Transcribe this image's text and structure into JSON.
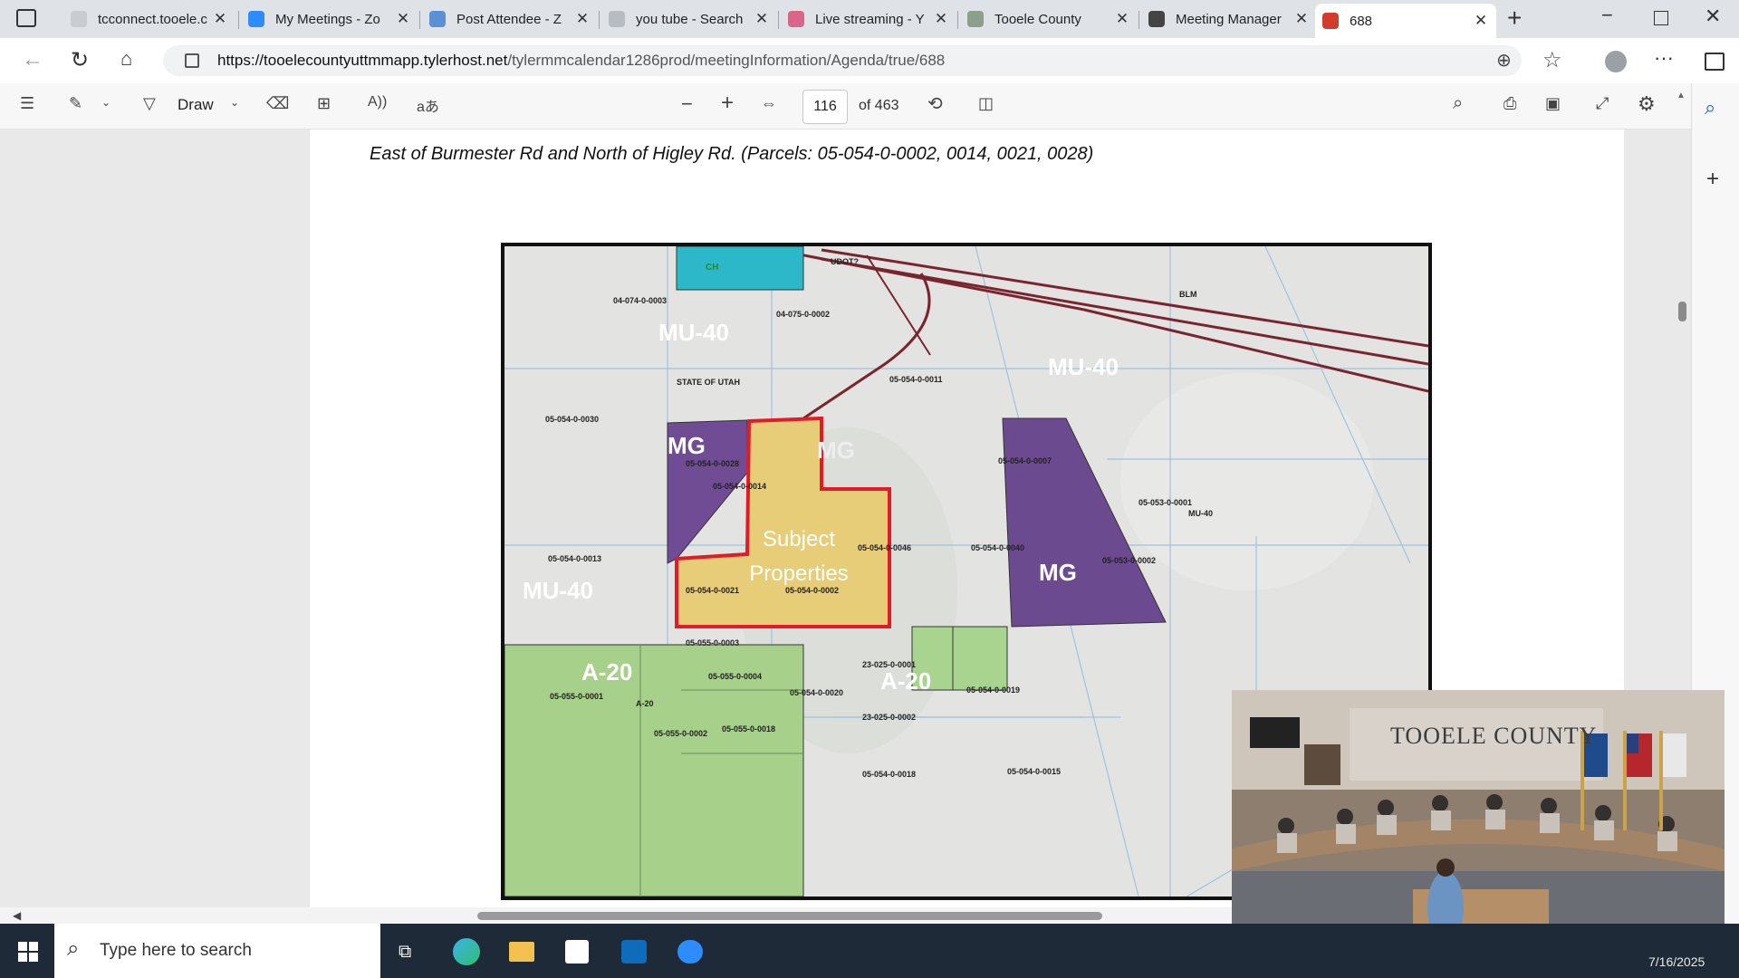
{
  "browser": {
    "tabs": [
      {
        "label": "tcconnect.tooele.c",
        "icon": "page-icon",
        "color": "#c9ccd0"
      },
      {
        "label": "My Meetings - Zo",
        "icon": "zoom-icon",
        "color": "#2d8cff"
      },
      {
        "label": "Post Attendee - Z",
        "icon": "zoom-icon",
        "color": "#5b8fd6"
      },
      {
        "label": "you tube - Search",
        "icon": "search-icon",
        "color": "#b7bcc2"
      },
      {
        "label": "Live streaming - Y",
        "icon": "youtube-icon",
        "color": "#d9668a"
      },
      {
        "label": "Tooele County",
        "icon": "tooele-icon",
        "color": "#8aa08a"
      },
      {
        "label": "Meeting Manager",
        "icon": "globe-icon",
        "color": "#444444"
      },
      {
        "label": "688",
        "icon": "pdf-icon",
        "color": "#d33b2c"
      }
    ],
    "url_host": "https://tooelecountyuttmmapp.tylerhost.net",
    "url_path": "/tylermmcalendar1286prod/meetingInformation/Agenda/true/688"
  },
  "pdf_toolbar": {
    "draw_label": "Draw",
    "current_page": "116",
    "total_pages": "of 463"
  },
  "document": {
    "caption": "East of Burmester Rd and North of Higley Rd. (Parcels: 05-054-0-0002, 0014, 0021, 0028)"
  },
  "map": {
    "zones": [
      {
        "label": "MU-40"
      },
      {
        "label": "MU-40"
      },
      {
        "label": "MU-40"
      },
      {
        "label": "MG"
      },
      {
        "label": "MG"
      },
      {
        "label": "MG"
      },
      {
        "label": "A-20"
      },
      {
        "label": "A-20"
      },
      {
        "label": "CH"
      }
    ],
    "subject_label": "Subject Properties",
    "small_labels": [
      "04-074-0-0003",
      "04-075-0-0002",
      "UDOT?",
      "BLM",
      "STATE OF UTAH",
      "05-054-0-0011",
      "05-054-0-0030",
      "05-054-0-0028",
      "05-054-0-0014",
      "05-054-0-0021",
      "05-054-0-0002",
      "05-054-0-0046",
      "05-054-0-0040",
      "05-054-0-0007",
      "05-053-0-0001",
      "05-053-0-0002",
      "05-054-0-0013",
      "05-055-0-0003",
      "05-055-0-0004",
      "05-055-0-0001",
      "05-055-0-0002",
      "05-055-0-0018",
      "05-054-0-0020",
      "23-025-0-0001",
      "23-025-0-0002",
      "05-054-0-0019",
      "05-054-0-0018",
      "05-054-0-0015",
      "MU-40",
      "A-20"
    ]
  },
  "taskbar": {
    "search_placeholder": "Type here to search",
    "date": "7/16/2025"
  },
  "video": {
    "room_sign": "TOOELE COUNTY"
  }
}
